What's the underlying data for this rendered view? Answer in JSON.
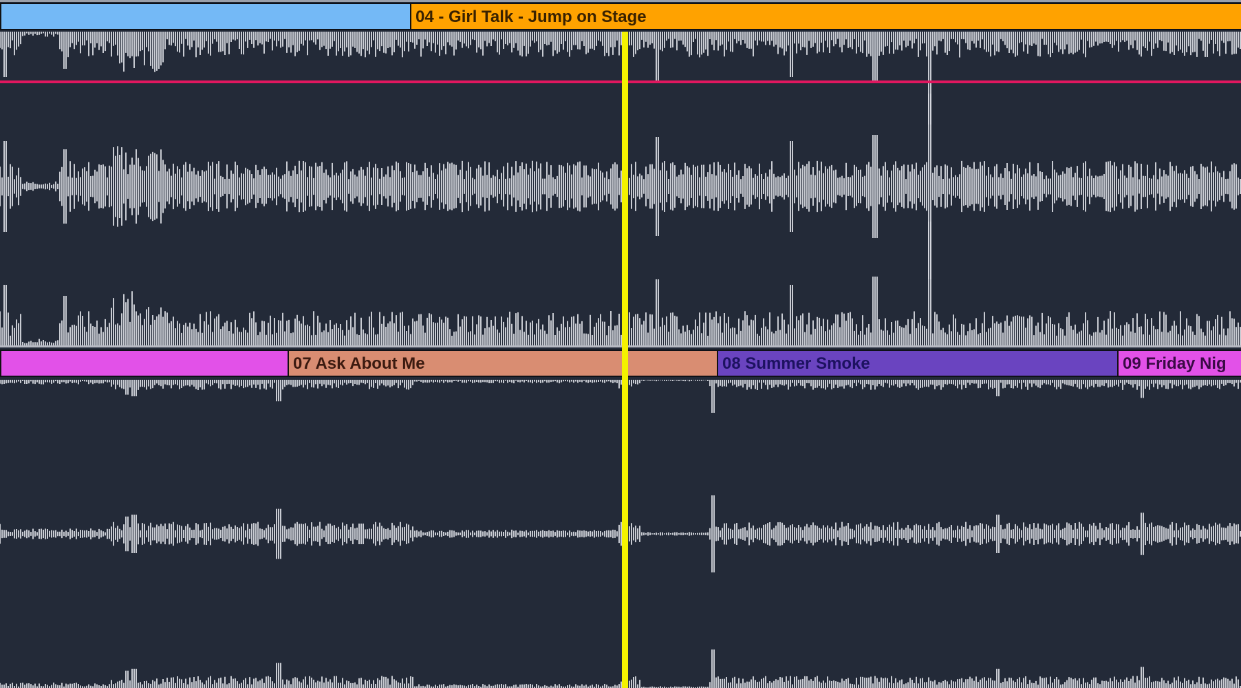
{
  "colors": {
    "background": "#232a38",
    "waveform": "#d7d9e0",
    "playhead": "#f4f200",
    "envelope": "#e0175f"
  },
  "track1": {
    "clips": [
      {
        "label": "",
        "color": "#74b9f6",
        "text_color": "#1a1a1a"
      },
      {
        "label": "04 - Girl Talk - Jump on Stage",
        "color": "#ffa200",
        "text_color": "#3a2200"
      }
    ]
  },
  "track2": {
    "clips": [
      {
        "label": "",
        "color": "#e251e8",
        "text_color": "#1a1a1a"
      },
      {
        "label": "07 Ask About Me",
        "color": "#d98d72",
        "text_color": "#3b1a10"
      },
      {
        "label": "08 Summer Smoke",
        "color": "#6a44c0",
        "text_color": "#1d1260"
      },
      {
        "label": "09 Friday Nig",
        "color": "#e251e8",
        "text_color": "#3a0a45"
      }
    ]
  }
}
